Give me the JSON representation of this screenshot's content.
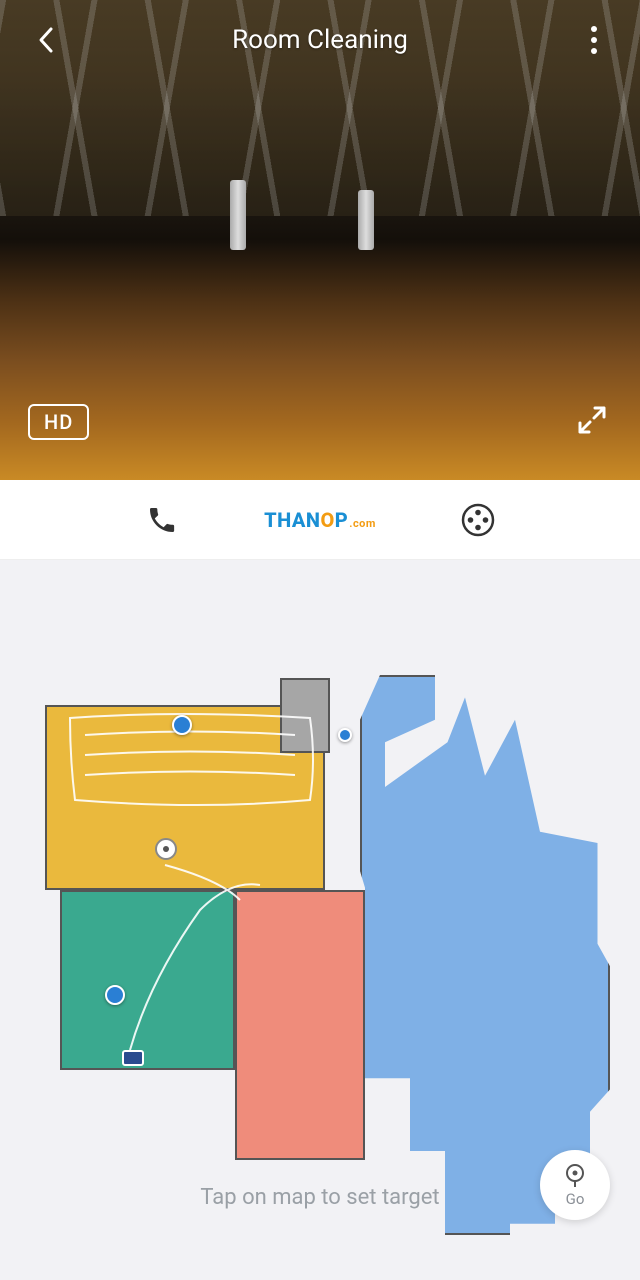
{
  "header": {
    "title": "Room Cleaning"
  },
  "camera": {
    "quality_badge": "HD"
  },
  "toolbar": {
    "logo_main": "THAN",
    "logo_o": "O",
    "logo_p": "P",
    "logo_suffix": ".com"
  },
  "map": {
    "hint_text": "Tap on map to set target",
    "rooms": [
      {
        "id": "room-yellow",
        "color": "yellow"
      },
      {
        "id": "room-gray",
        "color": "gray"
      },
      {
        "id": "room-green",
        "color": "green"
      },
      {
        "id": "room-red",
        "color": "red"
      },
      {
        "id": "room-blue",
        "color": "blue"
      }
    ]
  },
  "go_button": {
    "label": "Go"
  },
  "icons": {
    "back": "back-icon",
    "more": "more-icon",
    "expand": "expand-icon",
    "phone": "phone-icon",
    "film": "film-reel-icon",
    "target": "target-icon"
  }
}
